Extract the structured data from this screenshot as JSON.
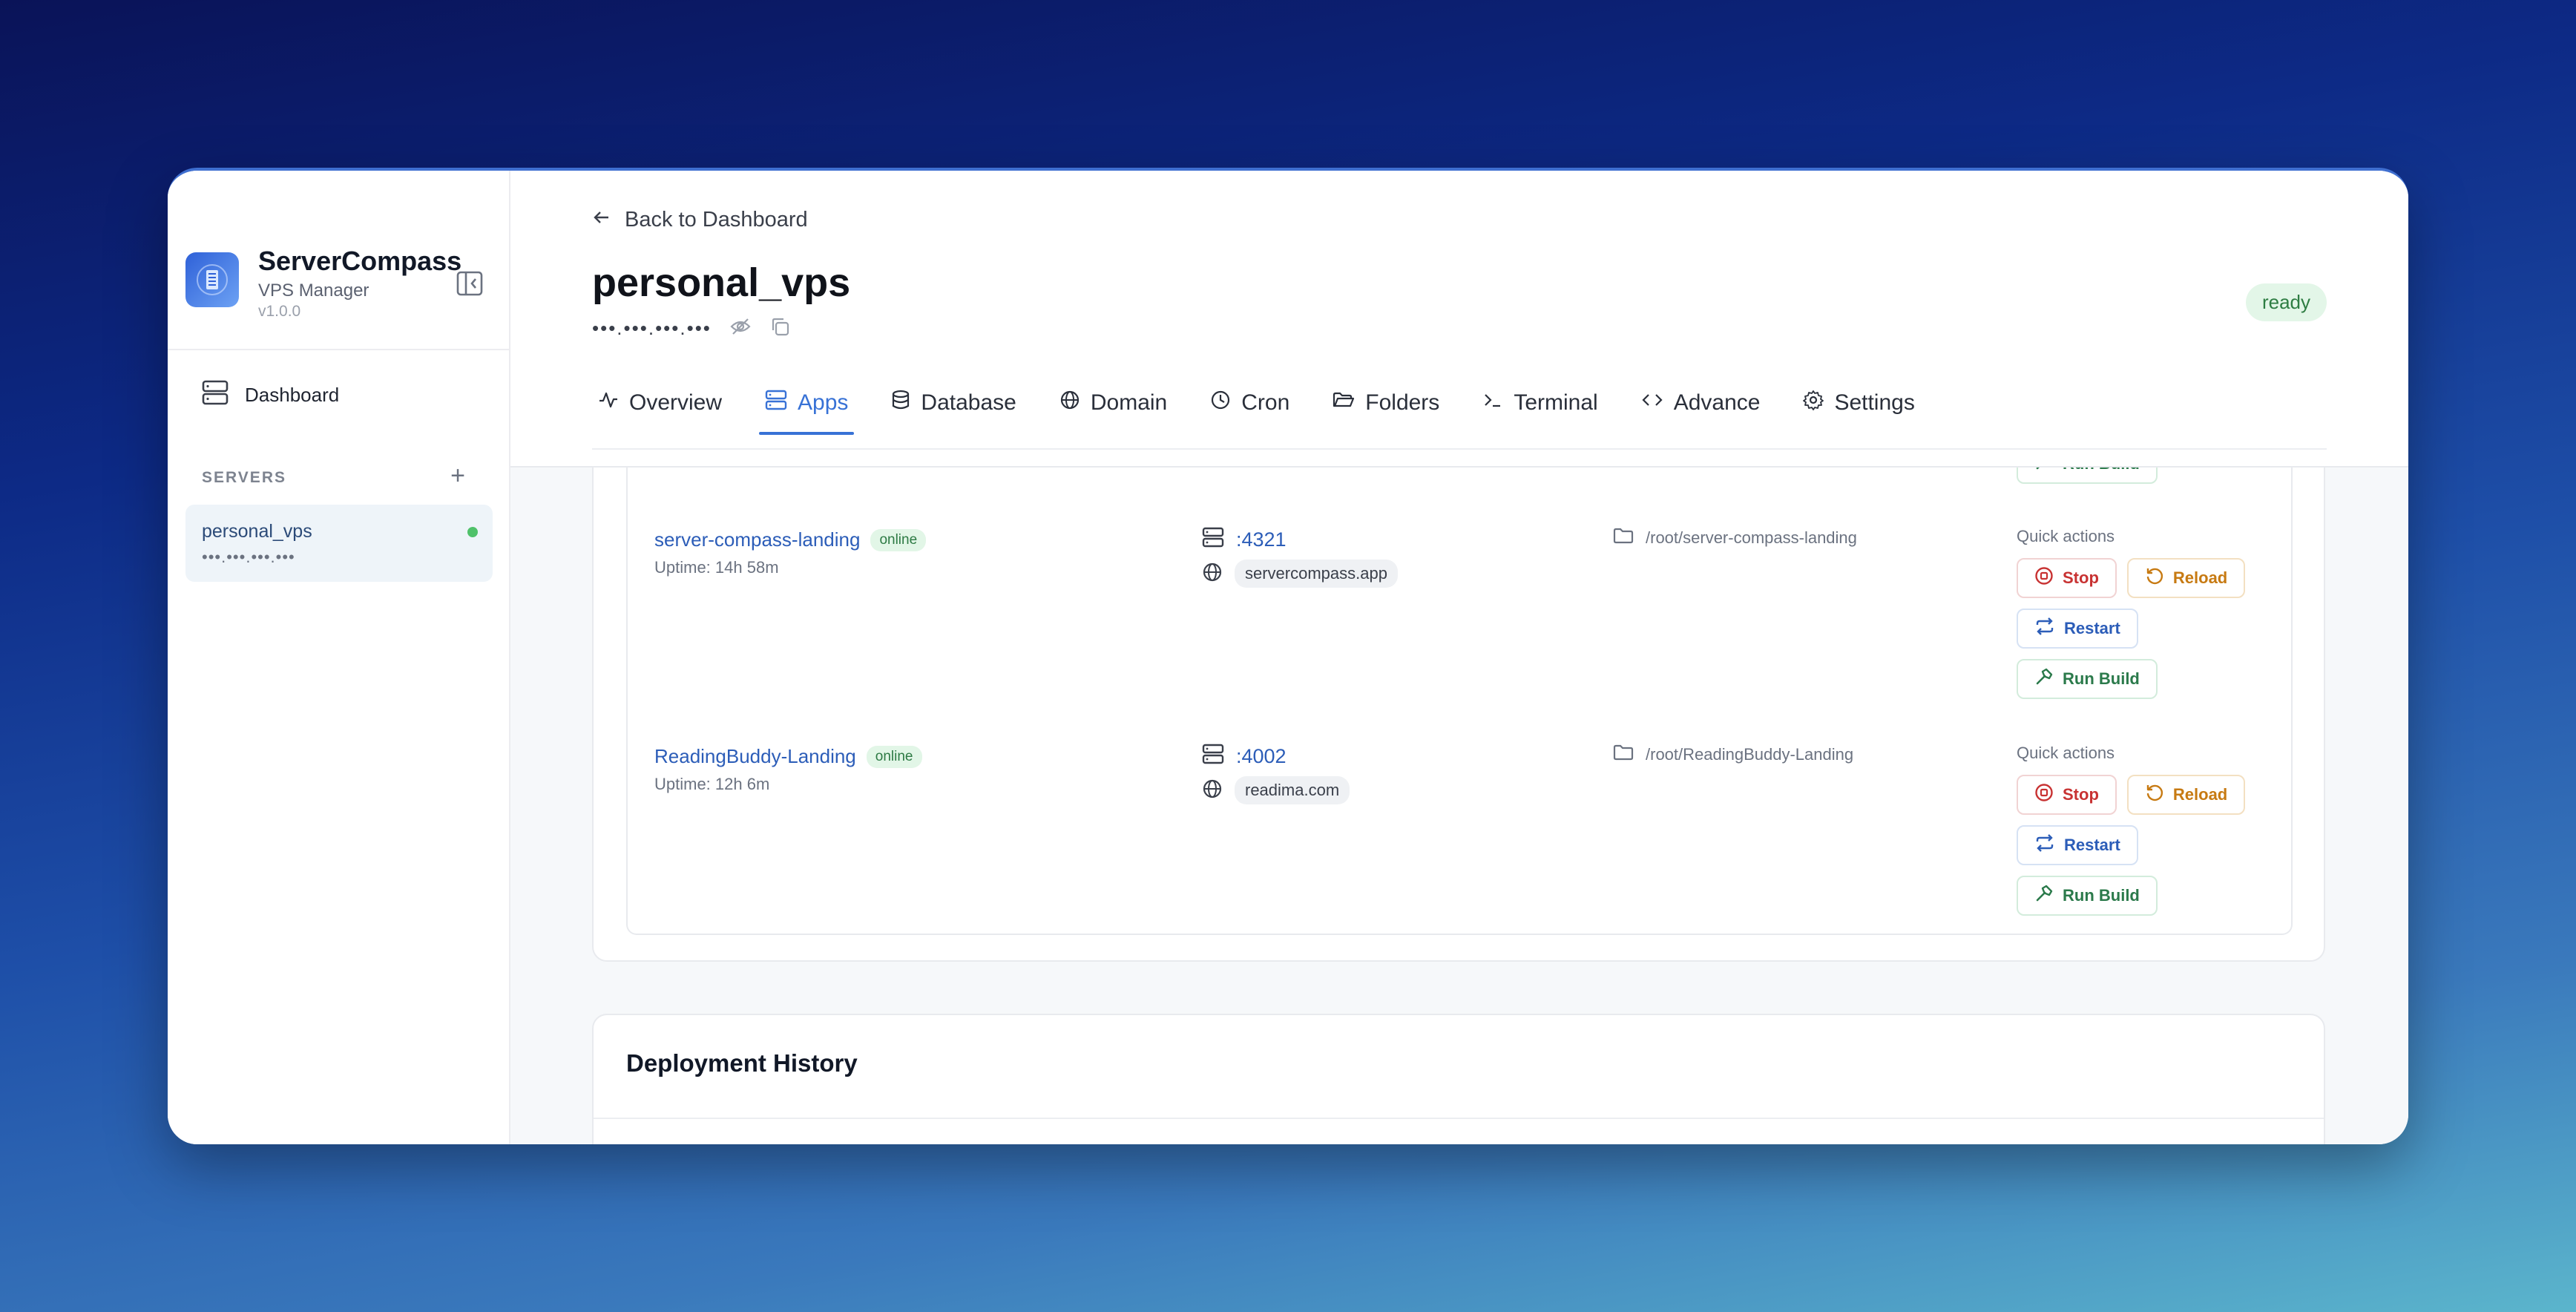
{
  "sidebar": {
    "brand_name": "ServerCompass",
    "brand_sub": "VPS Manager",
    "version": "v1.0.0",
    "nav_dashboard": "Dashboard",
    "servers_label": "SERVERS",
    "add_symbol": "+",
    "server": {
      "name": "personal_vps",
      "ip": "•••.•••.•••.•••",
      "status_color": "#4fc16a"
    }
  },
  "header": {
    "back_label": "Back to Dashboard",
    "title": "personal_vps",
    "ip_masked": "•••.•••.•••.•••",
    "status": "ready",
    "tabs": [
      {
        "label": "Overview",
        "icon": "activity-icon"
      },
      {
        "label": "Apps",
        "icon": "server-icon",
        "active": true
      },
      {
        "label": "Database",
        "icon": "database-icon"
      },
      {
        "label": "Domain",
        "icon": "globe-icon"
      },
      {
        "label": "Cron",
        "icon": "clock-icon"
      },
      {
        "label": "Folders",
        "icon": "folder-open-icon"
      },
      {
        "label": "Terminal",
        "icon": "terminal-icon"
      },
      {
        "label": "Advance",
        "icon": "code-icon"
      },
      {
        "label": "Settings",
        "icon": "gear-icon"
      }
    ]
  },
  "apps": {
    "top_build_label": "Run Build",
    "quick_actions_label": "Quick actions",
    "stop_label": "Stop",
    "reload_label": "Reload",
    "restart_label": "Restart",
    "build_label": "Run Build",
    "items": [
      {
        "name": "server-compass-landing",
        "status": "online",
        "uptime": "Uptime: 14h 58m",
        "port": ":4321",
        "domain": "servercompass.app",
        "path": "/root/server-compass-landing"
      },
      {
        "name": "ReadingBuddy-Landing",
        "status": "online",
        "uptime": "Uptime: 12h 6m",
        "port": ":4002",
        "domain": "readima.com",
        "path": "/root/ReadingBuddy-Landing"
      }
    ]
  },
  "history": {
    "title": "Deployment History"
  },
  "colors": {
    "accent": "#3872d6",
    "online": "#2d7a44",
    "stop": "#c83232",
    "reload": "#c77a12"
  }
}
